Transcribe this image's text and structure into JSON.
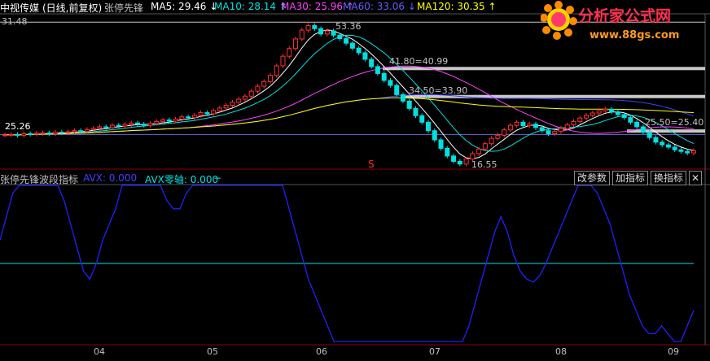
{
  "header": {
    "stock_name": "中视传媒",
    "period": "(日线,前复权)",
    "indicator_main": "张停先锋",
    "ma": [
      {
        "label": "MA5: 29.46 ↓",
        "color": "#ffffff"
      },
      {
        "label": "MA10: 28.14 ↑",
        "color": "#00e0e0"
      },
      {
        "label": "MA30: 25.96 ↑",
        "color": "#ff40ff"
      },
      {
        "label": "MA60: 33.06 ↓",
        "color": "#4040ff"
      },
      {
        "label": "MA120: 30.35 ↑",
        "color": "#ffff00"
      }
    ]
  },
  "logo": {
    "title": "分析家公式网",
    "url": "www.88gs.com"
  },
  "price_labels": {
    "top_left": "31.48",
    "left_level": "25.26",
    "peak": "53.36",
    "low": "16.55",
    "level_1": "41.80=40.99",
    "level_2": "34.50=33.90",
    "level_3": "25.50=25.40",
    "marker": "S"
  },
  "lower_panel": {
    "title": "张停先锋波段指标",
    "avx_label": "AVX: 0.000",
    "avx_zero_label": "AVX零轴: 0.000",
    "dash": "−",
    "buttons": {
      "change_params": "改参数",
      "add_indicator": "加指标",
      "swap_indicator": "换指标",
      "close": "✕"
    }
  },
  "x_axis": {
    "ticks": [
      "04",
      "05",
      "06",
      "07",
      "08",
      "09"
    ]
  },
  "chart_data": {
    "type": "line",
    "upper_ylim": [
      16.0,
      55.0
    ],
    "annotations": [
      {
        "label": "53.36",
        "x": "06 (early)",
        "y": 53.36
      },
      {
        "label": "16.55",
        "x": "07 (mid)",
        "y": 16.55
      },
      {
        "label": "41.80=40.99",
        "y": 41.8
      },
      {
        "label": "34.50=33.90",
        "y": 34.5
      },
      {
        "label": "25.50=25.40",
        "y": 25.5
      }
    ],
    "x_ticks": [
      "04",
      "05",
      "06",
      "07",
      "08",
      "09"
    ],
    "series": [
      {
        "name": "MA5",
        "color": "#ffffff"
      },
      {
        "name": "MA10",
        "color": "#00e0e0"
      },
      {
        "name": "MA30",
        "color": "#ff40ff"
      },
      {
        "name": "MA60",
        "color": "#4040ff"
      },
      {
        "name": "MA120",
        "color": "#ffff00"
      }
    ],
    "close": [
      24.5,
      24.6,
      24.4,
      24.8,
      24.7,
      24.9,
      25.0,
      24.8,
      25.2,
      25.1,
      25.3,
      25.6,
      25.4,
      25.9,
      26.2,
      26.6,
      26.4,
      27.0,
      26.8,
      27.2,
      27.6,
      27.3,
      27.0,
      27.5,
      28.0,
      28.4,
      28.1,
      28.6,
      29.2,
      29.0,
      29.6,
      30.3,
      30.0,
      30.8,
      31.5,
      32.2,
      33.0,
      33.8,
      34.6,
      35.9,
      37.2,
      38.4,
      40.0,
      42.5,
      45.0,
      47.0,
      49.5,
      51.8,
      53.0,
      52.2,
      50.8,
      51.6,
      50.5,
      49.6,
      48.4,
      47.1,
      45.9,
      44.2,
      42.3,
      40.5,
      38.7,
      37.4,
      35.0,
      33.3,
      31.4,
      29.5,
      27.8,
      25.6,
      23.2,
      21.0,
      19.0,
      17.6,
      16.9,
      18.2,
      19.6,
      20.8,
      22.2,
      23.6,
      24.4,
      25.8,
      27.0,
      27.8,
      26.9,
      27.3,
      26.4,
      25.6,
      24.8,
      25.4,
      26.2,
      27.1,
      28.0,
      28.9,
      29.6,
      30.2,
      30.8,
      31.2,
      30.5,
      29.8,
      29.0,
      27.8,
      26.6,
      25.2,
      23.8,
      22.6,
      21.9,
      21.3,
      20.6,
      20.2,
      19.8,
      20.4
    ],
    "avx": [
      65,
      80,
      95,
      100,
      100,
      100,
      100,
      100,
      100,
      100,
      90,
      75,
      60,
      45,
      40,
      50,
      65,
      75,
      85,
      100,
      100,
      100,
      100,
      100,
      100,
      100,
      90,
      85,
      85,
      95,
      100,
      100,
      100,
      100,
      100,
      100,
      100,
      100,
      100,
      100,
      100,
      100,
      100,
      100,
      100,
      85,
      70,
      55,
      40,
      30,
      20,
      10,
      0,
      0,
      0,
      0,
      0,
      0,
      0,
      0,
      0,
      0,
      0,
      0,
      0,
      0,
      0,
      0,
      0,
      0,
      0,
      0,
      0,
      10,
      25,
      40,
      55,
      70,
      80,
      70,
      55,
      45,
      40,
      38,
      42,
      50,
      60,
      70,
      80,
      90,
      100,
      100,
      100,
      95,
      85,
      75,
      60,
      45,
      30,
      20,
      10,
      5,
      5,
      10,
      5,
      0,
      0,
      10,
      20
    ]
  }
}
